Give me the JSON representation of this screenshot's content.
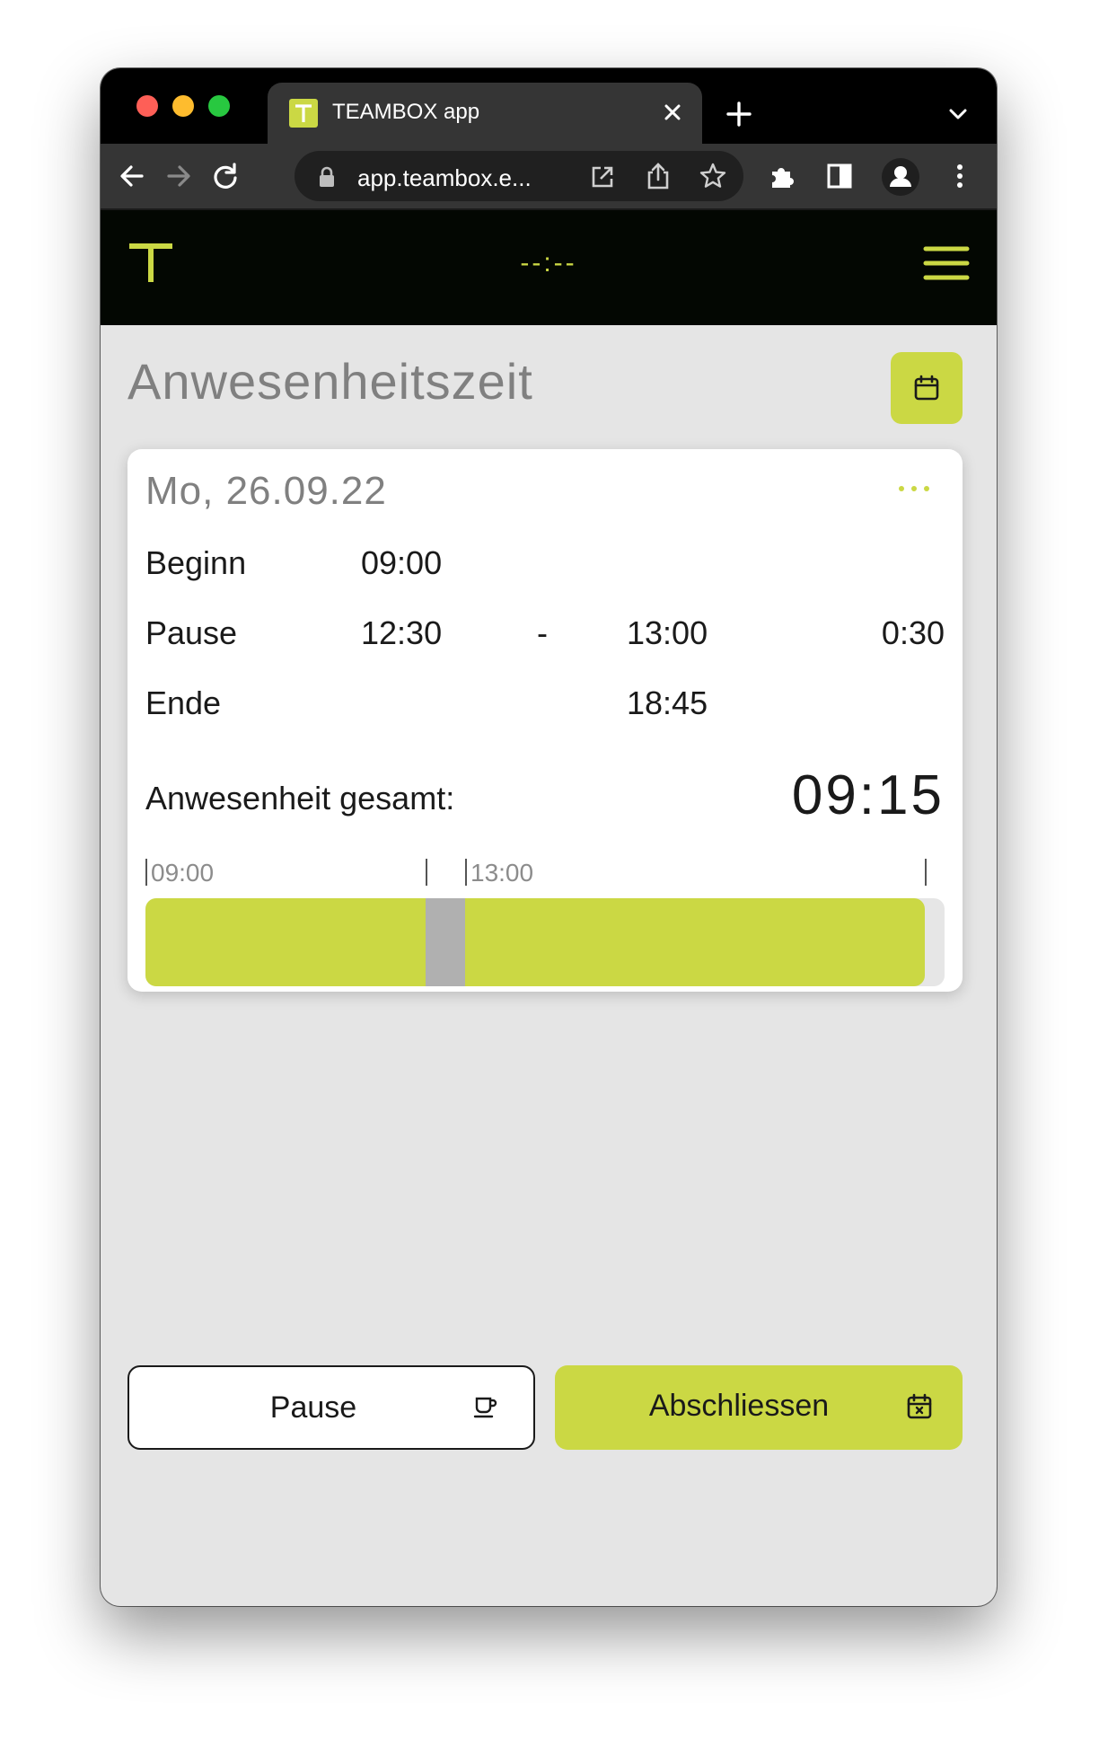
{
  "browser": {
    "tab_title": "TEAMBOX app",
    "url": "app.teambox.e...",
    "favicon_letter": "T",
    "icons": [
      "close-icon",
      "plus-icon",
      "chevron-down-icon",
      "back-arrow-icon",
      "forward-arrow-icon",
      "reload-icon",
      "lock-icon",
      "open-external-icon",
      "share-icon",
      "star-icon",
      "extensions-icon",
      "sidepanel-icon",
      "profile-icon",
      "kebab-menu-icon"
    ]
  },
  "app_header": {
    "logo_letter": "T",
    "clock": "--:--",
    "icons": [
      "teambox-logo",
      "hamburger-menu-icon"
    ]
  },
  "page": {
    "title": "Anwesenheitszeit"
  },
  "day": {
    "date": "Mo, 26.09.22",
    "rows": {
      "start_label": "Beginn",
      "start_time": "09:00",
      "break_label": "Pause",
      "break_start": "12:30",
      "break_dash": "-",
      "break_end": "13:00",
      "break_duration": "0:30",
      "end_label": "Ende",
      "end_time": "18:45"
    },
    "total_label": "Anwesenheit gesamt:",
    "total_value": "09:15",
    "timeline": {
      "label_start": "09:00",
      "label_mid": "13:00",
      "work_start": "09:00",
      "break_start": "12:30",
      "break_end": "13:00",
      "work_end": "18:45",
      "range_end": "19:00"
    }
  },
  "actions": {
    "pause_label": "Pause",
    "finish_label": "Abschliessen"
  },
  "colors": {
    "accent": "#cbd844",
    "header_bg": "#030702",
    "page_bg": "#e5e5e5",
    "break_gray": "#b0b0b0",
    "title_gray": "#808080"
  }
}
